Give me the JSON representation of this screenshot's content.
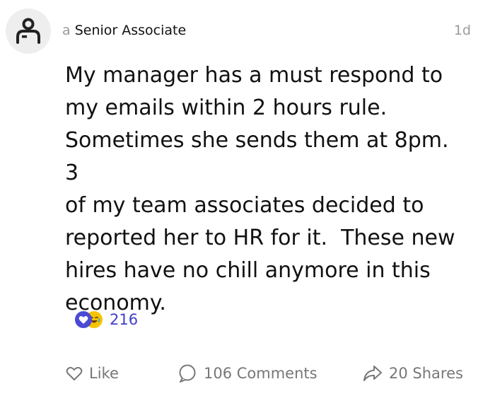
{
  "post": {
    "author_prefix": "a",
    "author_name": "Senior Associate",
    "timestamp": "1d",
    "body": "My manager has a must respond to\nmy emails within 2 hours rule.\nSometimes she sends them at 8pm. 3\nof my team associates decided to\nreported her to HR for it.  These new\nhires have no chill anymore in this\neconomy.",
    "reactions": {
      "icons": [
        "heart-reaction-icon",
        "laugh-reaction-icon"
      ],
      "count": "216"
    }
  },
  "actions": {
    "like_label": "Like",
    "comments_label": "106 Comments",
    "shares_label": "20 Shares"
  },
  "colors": {
    "reaction_count": "#4040c8",
    "heart_reaction": "#4a4ad6",
    "laugh_reaction": "#f5c400",
    "muted_text": "#9a9a9a",
    "action_text": "#777777",
    "avatar_bg": "#eeeeee"
  }
}
